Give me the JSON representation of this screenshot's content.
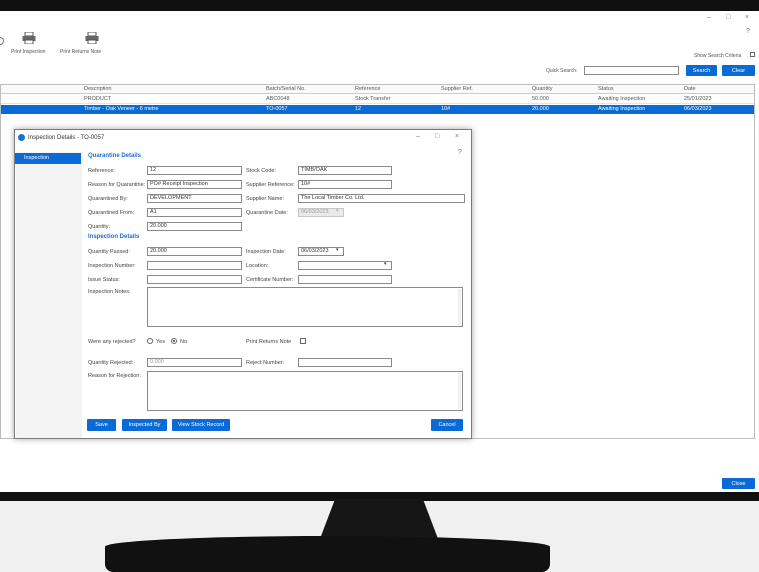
{
  "toolbar": {
    "print_inspection": "Print Inspection",
    "print_returns_note": "Print Returns Note",
    "show_search_criteria": "Show Search Criteria"
  },
  "search": {
    "label": "Quick Search:",
    "value": "",
    "search_button": "Search",
    "clear_button": "Clear"
  },
  "grid": {
    "columns": [
      "Description",
      "Batch/Serial No.",
      "Reference",
      "Supplier Ref.",
      "Quantity",
      "Status",
      "Date"
    ],
    "rows": [
      [
        "PRODUCT",
        "ABC0048",
        "Stock Transfer",
        "",
        "50.000",
        "Awaiting Inspection",
        "25/01/2023"
      ],
      [
        "Timber - Oak Veneer - 6 metre",
        "TO-0057",
        "12",
        "10#",
        "20.000",
        "Awaiting Inspection",
        "06/03/2023"
      ]
    ]
  },
  "dialog": {
    "title": "Inspection Details - TO-0057",
    "tab_inspection": "Inspection",
    "quarantine_section": "Quarantine Details",
    "reference_label": "Reference:",
    "reference_value": "12",
    "stock_code_label": "Stock Code:",
    "stock_code_value": "TIMB/OAK",
    "reason_label": "Reason for Quarantine:",
    "reason_value": "PO# Receipt Inspection",
    "supplier_ref_label": "Supplier Reference:",
    "supplier_ref_value": "10#",
    "quarantined_by_label": "Quarantined By:",
    "quarantined_by_value": "DEVELOPMENT",
    "supplier_name_label": "Supplier Name:",
    "supplier_name_value": "The Local Timber Co. Ltd.",
    "quarantined_from_label": "Quarantined From:",
    "quarantined_from_value": "A1",
    "quarantine_date_label": "Quarantine Date:",
    "quarantine_date_value": "06/03/2023",
    "quantity_label": "Quantity:",
    "quantity_value": "20.000",
    "inspection_section": "Inspection Details",
    "qty_passed_label": "Quantity Passed:",
    "qty_passed_value": "20.000",
    "inspection_date_label": "Inspection Date:",
    "inspection_date_value": "06/03/2023",
    "inspection_number_label": "Inspection Number:",
    "inspection_number_value": "",
    "location_label": "Location:",
    "location_value": "",
    "issue_status_label": "Issue Status:",
    "issue_status_value": "",
    "certificate_label": "Certificate Number:",
    "certificate_value": "",
    "notes_label": "Inspection Notes:",
    "rejected_question": "Were any rejected?",
    "yes_label": "Yes",
    "no_label": "No",
    "print_returns_label": "Print Returns Note",
    "qty_rejected_label": "Quantity Rejected:",
    "qty_rejected_value": "0.000",
    "reject_number_label": "Reject Number:",
    "reject_number_value": "",
    "reason_rejection_label": "Reason for Rejection:",
    "save_button": "Save",
    "inspected_by_button": "Inspected By",
    "view_stock_button": "View Stock Record",
    "cancel_button": "Cancel"
  },
  "footer": {
    "close_button": "Close"
  },
  "colors": {
    "accent": "#0a6bd6",
    "bezel": "#111111"
  }
}
